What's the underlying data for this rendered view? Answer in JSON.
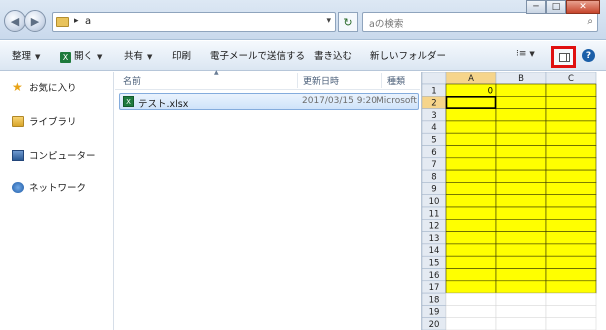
{
  "window": {
    "controls": {
      "minimize": "─",
      "maximize": "□",
      "close": "✕"
    }
  },
  "address_bar": {
    "separator": "▸",
    "path": "a",
    "dropdown_icon": "▾"
  },
  "refresh_icon": "↻",
  "search": {
    "placeholder": "aの検索",
    "icon": "search-icon"
  },
  "toolbar": {
    "organize": "整理",
    "open": "開く",
    "open_icon": "X",
    "share": "共有",
    "print": "印刷",
    "email": "電子メールで送信する",
    "burn": "書き込む",
    "new_folder": "新しいフォルダー",
    "view_icon": "⁝≡",
    "arrow": "▼",
    "help": "?"
  },
  "nav": {
    "favorites": "お気に入り",
    "libraries": "ライブラリ",
    "computer": "コンピューター",
    "network": "ネットワーク"
  },
  "columns": {
    "name": "名前",
    "date": "更新日時",
    "type": "種類"
  },
  "files": [
    {
      "name": "テスト.xlsx",
      "date": "2017/03/15 9:20",
      "type": "Microsoft Excel"
    }
  ],
  "sheet": {
    "columns": [
      "A",
      "B",
      "C"
    ],
    "rows": [
      "1",
      "2",
      "3",
      "4",
      "5",
      "6",
      "7",
      "8",
      "9",
      "10",
      "11",
      "12",
      "13",
      "14",
      "15",
      "16",
      "17",
      "18",
      "19",
      "20"
    ],
    "cell_values": [
      {
        "cell": "A1",
        "value": "0"
      }
    ],
    "active_cell": "A2",
    "highlight_rows": 17,
    "highlight_color": "#ffff00"
  }
}
